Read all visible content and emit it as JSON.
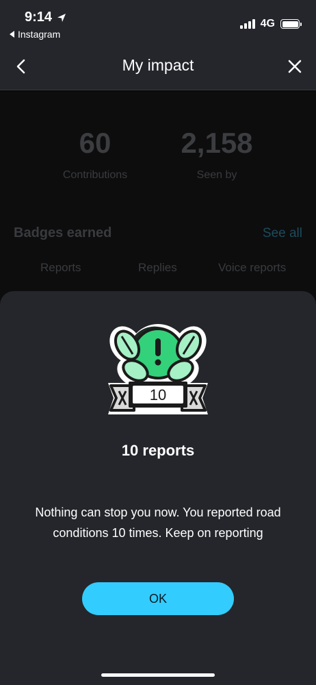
{
  "status_bar": {
    "time": "9:14",
    "back_app": "Instagram",
    "network": "4G"
  },
  "nav": {
    "title": "My impact"
  },
  "stats": {
    "contributions_value": "60",
    "contributions_label": "Contributions",
    "seen_by_value": "2,158",
    "seen_by_label": "Seen by"
  },
  "badges": {
    "heading": "Badges earned",
    "see_all": "See all",
    "tabs": [
      "Reports",
      "Replies",
      "Voice reports"
    ]
  },
  "sheet": {
    "badge_number": "10",
    "title": "10 reports",
    "description": "Nothing can stop you now. You reported road conditions 10 times. Keep on reporting",
    "ok_label": "OK"
  },
  "colors": {
    "accent": "#33ccff",
    "sheet_bg": "#24262b",
    "badge_green": "#33d17a"
  }
}
